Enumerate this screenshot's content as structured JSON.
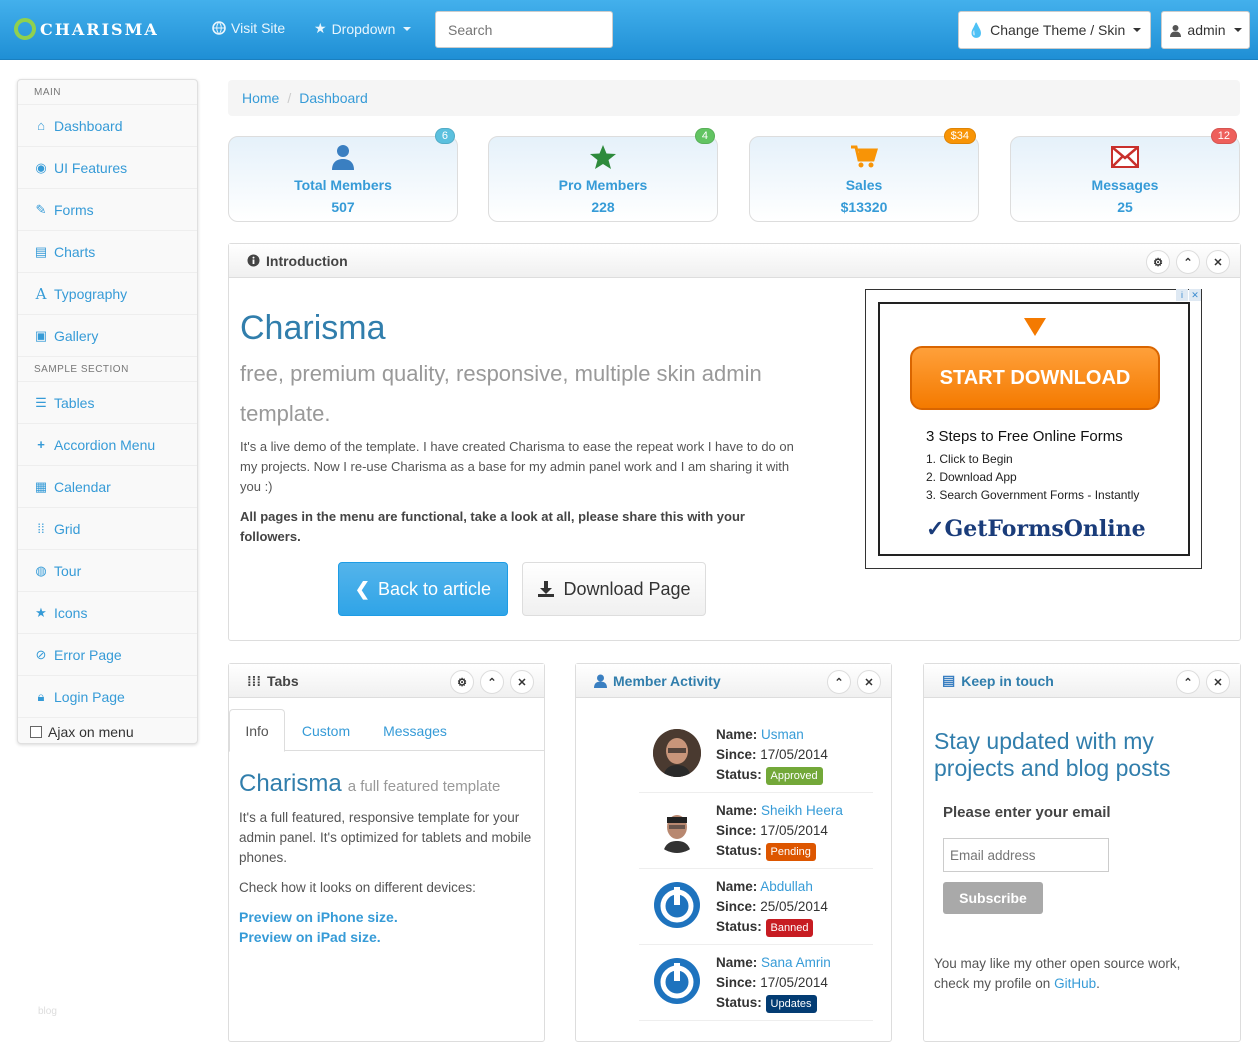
{
  "brand": {
    "name": "CHARISMA"
  },
  "nav": {
    "visit_site": "Visit Site",
    "dropdown": "Dropdown",
    "search_placeholder": "Search",
    "theme": "Change Theme / Skin",
    "user": "admin"
  },
  "sidebar": {
    "main_header": "MAIN",
    "sample_header": "SAMPLE SECTION",
    "items": [
      {
        "label": "Dashboard",
        "icon": "home-icon"
      },
      {
        "label": "UI Features",
        "icon": "eye-icon"
      },
      {
        "label": "Forms",
        "icon": "edit-icon"
      },
      {
        "label": "Charts",
        "icon": "list-alt-icon"
      },
      {
        "label": "Typography",
        "icon": "font-icon"
      },
      {
        "label": "Gallery",
        "icon": "picture-icon"
      },
      {
        "label": "Tables",
        "icon": "align-justify-icon"
      },
      {
        "label": "Accordion Menu",
        "icon": "plus-icon"
      },
      {
        "label": "Calendar",
        "icon": "calendar-icon"
      },
      {
        "label": "Grid",
        "icon": "th-icon"
      },
      {
        "label": "Tour",
        "icon": "globe-icon"
      },
      {
        "label": "Icons",
        "icon": "star-icon"
      },
      {
        "label": "Error Page",
        "icon": "ban-icon"
      },
      {
        "label": "Login Page",
        "icon": "lock-icon"
      }
    ],
    "ajax_label": "Ajax on menu"
  },
  "breadcrumb": [
    "Home",
    "Dashboard"
  ],
  "stats": [
    {
      "label": "Total Members",
      "value": "507",
      "badge": "6",
      "badge_color": "#5bc0de",
      "icon": "user-icon"
    },
    {
      "label": "Pro Members",
      "value": "228",
      "badge": "4",
      "badge_color": "#62c462",
      "icon": "star-icon"
    },
    {
      "label": "Sales",
      "value": "$13320",
      "badge": "$34",
      "badge_color": "#f89406",
      "icon": "cart-icon"
    },
    {
      "label": "Messages",
      "value": "25",
      "badge": "12",
      "badge_color": "#ee5f5b",
      "icon": "envelope-icon"
    }
  ],
  "intro": {
    "header": "Introduction",
    "title": "Charisma",
    "subtitle": "free, premium quality, responsive, multiple skin admin template.",
    "paragraph": "It's a live demo of the template. I have created Charisma to ease the repeat work I have to do on my projects. Now I re-use Charisma as a base for my admin panel work and I am sharing it with you :)",
    "bold": "All pages in the menu are functional, take a look at all, please share this with your followers.",
    "back_btn": "Back to article",
    "download_btn": "Download Page"
  },
  "ad": {
    "button": "START DOWNLOAD",
    "heading": "3 Steps to Free Online Forms",
    "steps": [
      "1. Click to Begin",
      "2. Download App",
      "3. Search Government Forms - Instantly"
    ],
    "logo": "GetFormsOnline"
  },
  "tabs_box": {
    "header": "Tabs",
    "tabs": [
      "Info",
      "Custom",
      "Messages"
    ],
    "title": "Charisma",
    "title_small": "a full featured template",
    "p1": "It's a full featured, responsive template for your admin panel. It's optimized for tablets and mobile phones.",
    "p2": "Check how it looks on different devices:",
    "link1": "Preview on iPhone size.",
    "link2": "Preview on iPad size."
  },
  "member_activity": {
    "header": "Member Activity",
    "name_label": "Name:",
    "since_label": "Since:",
    "status_label": "Status:",
    "members": [
      {
        "name": "Usman",
        "since": "17/05/2014",
        "status": "Approved",
        "status_color": "#73a839"
      },
      {
        "name": "Sheikh Heera",
        "since": "17/05/2014",
        "status": "Pending",
        "status_color": "#dd5600"
      },
      {
        "name": "Abdullah",
        "since": "25/05/2014",
        "status": "Banned",
        "status_color": "#c71c22"
      },
      {
        "name": "Sana Amrin",
        "since": "17/05/2014",
        "status": "Updates",
        "status_color": "#033c73"
      }
    ]
  },
  "keep_in_touch": {
    "header": "Keep in touch",
    "heading": "Stay updated with my projects and blog posts",
    "label": "Please enter your email",
    "placeholder": "Email address",
    "button": "Subscribe",
    "footer_text": "You may like my other open source work, check my profile on",
    "footer_link": "GitHub",
    "footer_end": "."
  },
  "faint": "blog"
}
